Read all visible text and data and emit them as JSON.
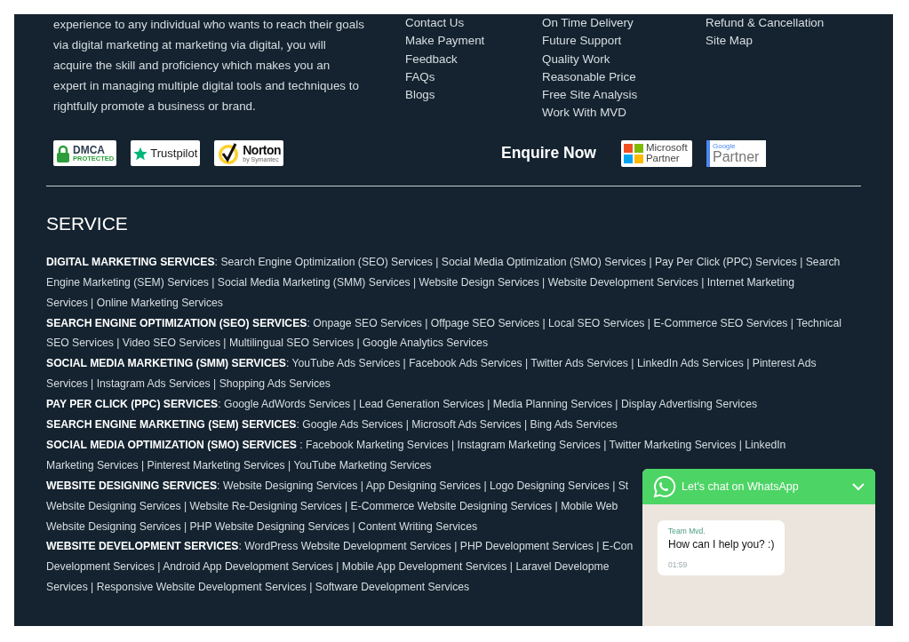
{
  "about": {
    "text": "experience to any individual who wants to reach their goals via digital marketing at marketing via digital, you will acquire the skill and proficiency which makes you an expert in managing multiple digital tools and techniques to rightfully promote a business or brand."
  },
  "link_columns": [
    [
      "Contact Us",
      "Make Payment",
      "Feedback",
      "FAQs",
      "Blogs"
    ],
    [
      "On Time Delivery",
      "Future Support",
      "Quality Work",
      "Reasonable Price",
      "Free Site Analysis",
      "Work With MVD"
    ],
    [
      "Refund & Cancellation",
      "Site Map"
    ]
  ],
  "badges": [
    {
      "kind": "dmca",
      "lines": [
        "DMCA",
        "PROTECTED"
      ]
    },
    {
      "kind": "trustpilot",
      "lines": [
        "Trustpilot"
      ]
    },
    {
      "kind": "norton",
      "lines": [
        "Norton",
        "by Symantec"
      ]
    }
  ],
  "enquire": "Enquire Now",
  "partners": [
    {
      "kind": "microsoft",
      "lines": [
        "Microsoft",
        "Partner"
      ]
    },
    {
      "kind": "google",
      "lines": [
        "Google",
        "Partner"
      ]
    }
  ],
  "service": {
    "title": "SERVICE",
    "lines": [
      "**DIGITAL MARKETING SERVICES**: Search Engine Optimization (SEO) Services | Social Media Optimization (SMO) Services | Pay Per Click (PPC) Services | Search",
      "Engine Marketing (SEM) Services | Social Media Marketing (SMM) Services | Website Design Services | Website Development Services | Internet Marketing",
      "Services | Online Marketing Services",
      "**SEARCH ENGINE OPTIMIZATION (SEO) SERVICES**: Onpage SEO Services | Offpage SEO Services | Local SEO Services | E-Commerce SEO Services | Technical",
      "SEO Services | Video SEO Services | Multilingual SEO Services | Google Analytics Services",
      "**SOCIAL MEDIA MARKETING (SMM) SERVICES**: YouTube Ads Services | Facebook Ads Services | Twitter Ads Services | LinkedIn Ads Services | Pinterest Ads",
      "Services | Instagram Ads Services | Shopping Ads Services",
      "**PAY PER CLICK (PPC) SERVICES**: Google AdWords Services | Lead Generation Services | Media Planning Services | Display Advertising Services",
      "**SEARCH ENGINE MARKETING (SEM) SERVICES**: Google Ads Services | Microsoft Ads Services | Bing Ads Services",
      "**SOCIAL MEDIA OPTIMIZATION (SMO) SERVICES** : Facebook Marketing Services | Instagram Marketing Services | Twitter Marketing Services | LinkedIn",
      "Marketing Services | Pinterest Marketing Services | YouTube Marketing Services",
      "**WEBSITE DESIGNING SERVICES**: Website Designing Services | App Designing Services | Logo Designing Services | St",
      "Website Designing Services | Website Re-Designing Services | E-Commerce Website Designing Services | Mobile Web",
      "Website Designing Services | PHP Website Designing Services | Content Writing Services",
      "**WEBSITE DEVELOPMENT SERVICES**: WordPress Website Development Services | PHP Development Services | E-Con",
      "Development Services | Android App Development Services | Mobile App Development Services | Laravel Developme",
      "Services | Responsive Website Development Services | Software Development Services"
    ]
  },
  "chat": {
    "title": "Let's chat on WhatsApp",
    "message": {
      "sender": "Team Mvd.",
      "text": "How can I help you? :)",
      "time": "01:59"
    }
  }
}
